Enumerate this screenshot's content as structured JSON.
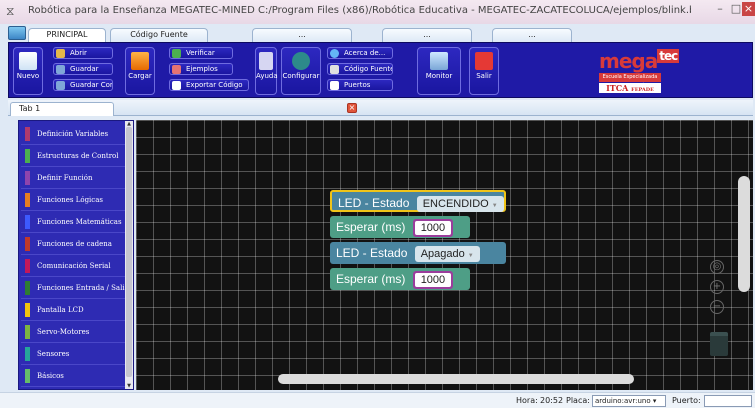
{
  "window": {
    "title": "Robótica para la Enseñanza MEGATEC-MINED C:/Program Files (x86)/Robótica Educativa - MEGATEC-ZACATECOLUCA/ejemplos/blink.bly"
  },
  "ribbon_tabs": [
    "PRINCIPAL",
    "Código Fuente",
    "...",
    "...",
    "..."
  ],
  "ribbon": {
    "nuevo": "Nuevo",
    "abrir": "Abrir",
    "guardar": "Guardar",
    "guardar_como": "Guardar Como",
    "cargar": "Cargar",
    "verificar": "Verificar",
    "ejemplos": "Ejemplos",
    "exportar": "Exportar Código",
    "ayuda": "Ayuda",
    "configurar": "Configurar",
    "acerca": "Acerca de...",
    "codigo_fuente": "Código Fuente",
    "puertos": "Puertos",
    "monitor": "Monitor",
    "salir": "Salir"
  },
  "logo": {
    "mega": "mega",
    "tec": "tec",
    "line1": "Escuela Especializada en Ingeniería",
    "line2": "ITCA",
    "line3": "FEPADE"
  },
  "doc_tabs": [
    {
      "label": "Tab 1"
    }
  ],
  "categories": [
    {
      "label": "Definición Variables",
      "color": "#b03a6e"
    },
    {
      "label": "Estructuras de Control",
      "color": "#4caf50"
    },
    {
      "label": "Definir Función",
      "color": "#8e44ad"
    },
    {
      "label": "Funciones Lógicas",
      "color": "#e67e22"
    },
    {
      "label": "Funciones Matemáticas",
      "color": "#3d5afe"
    },
    {
      "label": "Funciones de cadena",
      "color": "#c0392b"
    },
    {
      "label": "Comunicación Serial",
      "color": "#c2185b"
    },
    {
      "label": "Funciones Entrada / Salida",
      "color": "#2e7d32"
    },
    {
      "label": "Pantalla LCD",
      "color": "#f1c40f"
    },
    {
      "label": "Servo-Motores",
      "color": "#7cb342"
    },
    {
      "label": "Sensores",
      "color": "#26a69a"
    },
    {
      "label": "Básicos",
      "color": "#66bb6a"
    }
  ],
  "blocks": {
    "led1": {
      "label": "LED - Estado",
      "value": "ENCENDIDO"
    },
    "wait1": {
      "label": "Esperar (ms)",
      "value": "1000"
    },
    "led2": {
      "label": "LED - Estado",
      "value": "Apagado"
    },
    "wait2": {
      "label": "Esperar (ms)",
      "value": "1000"
    }
  },
  "status": {
    "hora_label": "Hora:",
    "hora": "20:52",
    "placa_label": "Placa:",
    "placa": "arduino:avr:uno",
    "puerto_label": "Puerto:",
    "puerto": ""
  },
  "icons": {
    "app": "app-icon",
    "nuevo": "new-document-icon",
    "abrir": "open-folder-icon",
    "guardar": "save-icon",
    "cargar": "upload-arrow-icon",
    "verificar": "check-icon",
    "ejemplos": "examples-icon",
    "exportar": "export-icon",
    "ayuda": "help-icon",
    "configurar": "gear-icon",
    "acerca": "info-icon",
    "codigo_fuente": "code-icon",
    "puertos": "port-icon",
    "monitor": "monitor-icon",
    "salir": "exit-icon",
    "trash": "trash-icon"
  }
}
